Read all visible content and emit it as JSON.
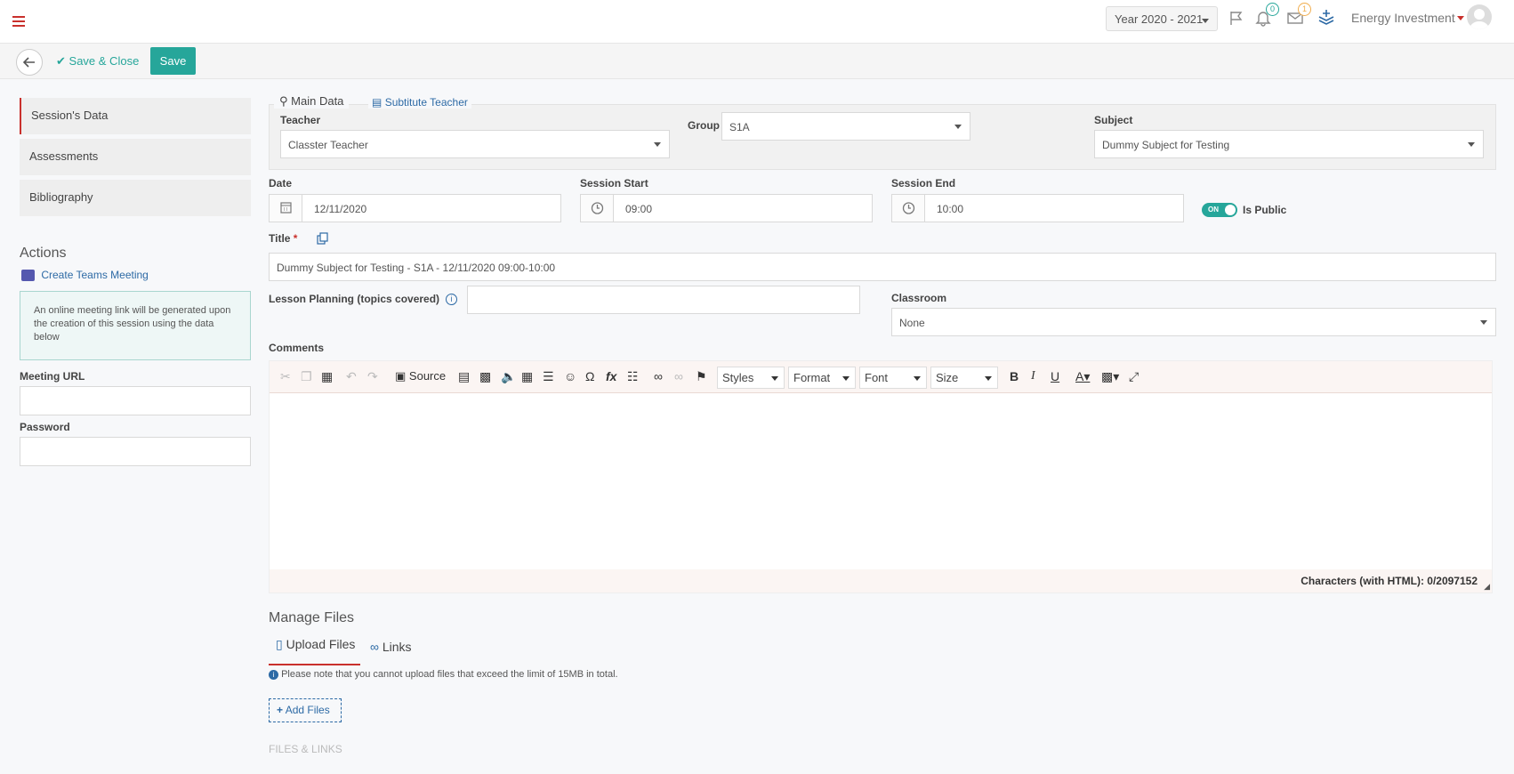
{
  "header": {
    "year": "Year 2020 - 2021",
    "notifications_count": "0",
    "messages_count": "1",
    "user_name": "Energy Investment"
  },
  "toolbar": {
    "save_close_label": "Save & Close",
    "save_label": "Save"
  },
  "sidebar": {
    "items": [
      {
        "label": "Session's Data"
      },
      {
        "label": "Assessments"
      },
      {
        "label": "Bibliography"
      }
    ],
    "actions_title": "Actions",
    "teams_link": "Create Teams Meeting",
    "info_text": "An online meeting link will be generated upon the creation of this session using the data below",
    "meeting_url_label": "Meeting URL",
    "password_label": "Password"
  },
  "tabs": {
    "main_data": "Main Data",
    "substitute": "Subtitute Teacher"
  },
  "form": {
    "teacher_label": "Teacher",
    "teacher_value": "Classter Teacher",
    "group_label": "Group",
    "group_value": "S1A",
    "subject_label": "Subject",
    "subject_value": "Dummy Subject for Testing",
    "date_label": "Date",
    "date_value": "12/11/2020",
    "session_start_label": "Session Start",
    "session_start_value": "09:00",
    "session_end_label": "Session End",
    "session_end_value": "10:00",
    "toggle_label": "ON",
    "is_public_label": "Is Public",
    "title_label": "Title",
    "title_required": "*",
    "title_value": "Dummy Subject for Testing - S1A - 12/11/2020 09:00-10:00",
    "lesson_planning_label": "Lesson Planning (topics covered)",
    "classroom_label": "Classroom",
    "classroom_value": "None",
    "comments_label": "Comments"
  },
  "editor": {
    "source_label": "Source",
    "styles_label": "Styles",
    "format_label": "Format",
    "font_label": "Font",
    "size_label": "Size",
    "char_count": "Characters (with HTML): 0/2097152"
  },
  "files": {
    "title": "Manage Files",
    "upload_tab": "Upload Files",
    "links_tab": "Links",
    "note": "Please note that you cannot upload files that exceed the limit of 15MB in total.",
    "add_files": "Add Files",
    "files_links_heading": "FILES & LINKS"
  },
  "colors": {
    "accent": "#26a69a",
    "brand_red": "#c9302c",
    "link_blue": "#2d6aa5"
  }
}
